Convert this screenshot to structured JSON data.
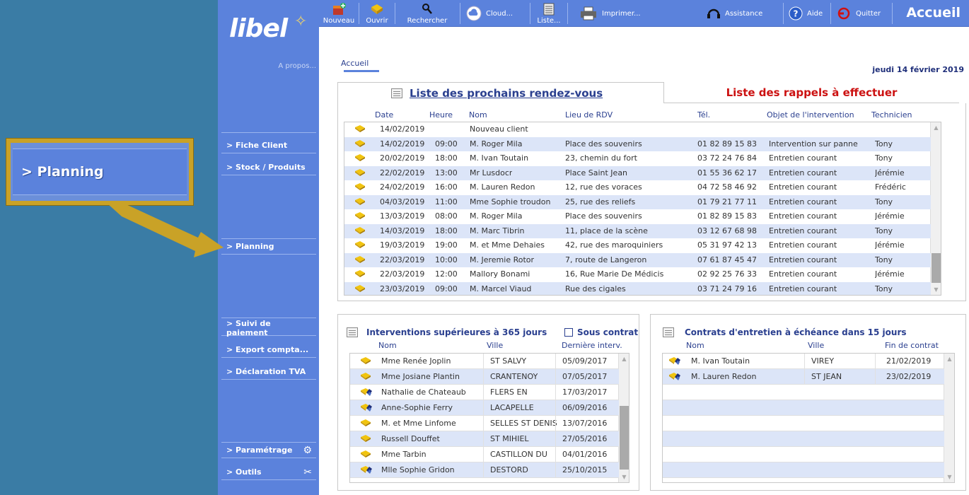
{
  "callout": {
    "label": ">  Planning"
  },
  "app": {
    "logo": "libel",
    "apropos": "A propos..."
  },
  "sidebar": {
    "items": [
      {
        "label": "> Fiche Client",
        "icon": ""
      },
      {
        "label": "> Stock / Produits",
        "icon": ""
      },
      {
        "label": "> Planning",
        "icon": ""
      },
      {
        "label": "> Suivi de paiement",
        "icon": ""
      },
      {
        "label": "> Export compta...",
        "icon": ""
      },
      {
        "label": "> Déclaration TVA",
        "icon": ""
      },
      {
        "label": "> Paramétrage",
        "icon": "gears-icon"
      },
      {
        "label": "> Outils",
        "icon": "tools-icon"
      }
    ]
  },
  "toolbar": {
    "nouveau": "Nouveau",
    "ouvrir": "Ouvrir",
    "rechercher": "Rechercher",
    "cloud": "Cloud...",
    "liste": "Liste...",
    "imprimer": "Imprimer...",
    "assistance": "Assistance",
    "aide": "Aide",
    "quitter": "Quitter",
    "title": "Accueil"
  },
  "content": {
    "breadcrumb": "Accueil",
    "date": "jeudi 14 février 2019"
  },
  "tabs": {
    "active": "Liste des prochains rendez-vous",
    "inactive": "Liste des rappels à effectuer"
  },
  "rdv_table": {
    "headers": [
      "Date",
      "Heure",
      "Nom",
      "Lieu de RDV",
      "Tél.",
      "Objet  de l'intervention",
      "Technicien"
    ],
    "rows": [
      [
        "14/02/2019",
        "",
        "Nouveau client",
        "",
        "",
        "",
        ""
      ],
      [
        "14/02/2019",
        "09:00",
        "M. Roger Mila",
        "Place des souvenirs",
        "01 82 89 15 83",
        "Intervention sur panne",
        "Tony"
      ],
      [
        "20/02/2019",
        "18:00",
        "M. Ivan Toutain",
        "23, chemin du fort",
        "03 72 24 76 84",
        "Entretien courant",
        "Tony"
      ],
      [
        "22/02/2019",
        "13:00",
        "Mr Lusdocr",
        "Place Saint Jean",
        "01 55 36 62 17",
        "Entretien courant",
        "Jérémie"
      ],
      [
        "24/02/2019",
        "16:00",
        "M. Lauren Redon",
        "12, rue des voraces",
        "04 72 58 46 92",
        "Entretien courant",
        "Frédéric"
      ],
      [
        "04/03/2019",
        "11:00",
        "Mme Sophie troudon",
        "25, rue des reliefs",
        "01 79 21 77 11",
        "Entretien courant",
        "Tony"
      ],
      [
        "13/03/2019",
        "08:00",
        "M. Roger Mila",
        "Place des souvenirs",
        "01 82 89 15 83",
        "Entretien courant",
        "Jérémie"
      ],
      [
        "14/03/2019",
        "18:00",
        "M. Marc Tibrin",
        "11, place de la scène",
        "03 12 67 68 98",
        "Entretien courant",
        "Tony"
      ],
      [
        "19/03/2019",
        "19:00",
        "M. et Mme Dehaies",
        "42, rue des maroquiniers",
        "05 31 97 42 13",
        "Entretien courant",
        "Jérémie"
      ],
      [
        "22/03/2019",
        "10:00",
        "M. Jeremie Rotor",
        "7, route de Langeron",
        "07 61 87 45 47",
        "Entretien courant",
        "Tony"
      ],
      [
        "22/03/2019",
        "12:00",
        "Mallory Bonami",
        "16, Rue Marie De Médicis",
        "02 92 25 76 33",
        "Entretien courant",
        "Jérémie"
      ],
      [
        "23/03/2019",
        "09:00",
        "M. Marcel Viaud",
        "Rue des cigales",
        "03 71 24 79 16",
        "Entretien courant",
        "Tony"
      ]
    ]
  },
  "interventions": {
    "title": "Interventions supérieures à 365 jours",
    "sous_contrat": "Sous contrat",
    "headers": [
      "Nom",
      "Ville",
      "Dernière interv."
    ],
    "rows": [
      [
        "Mme Renée Joplin",
        "ST SALVY",
        "05/09/2017",
        "single"
      ],
      [
        "Mme Josiane Plantin",
        "CRANTENOY",
        "07/05/2017",
        "single"
      ],
      [
        "Nathalie de Chateaub",
        "FLERS EN",
        "17/03/2017",
        "double"
      ],
      [
        "Anne-Sophie Ferry",
        "LACAPELLE",
        "06/09/2016",
        "double"
      ],
      [
        "M. et Mme Linfome",
        "SELLES ST DENIS",
        "13/07/2016",
        "single"
      ],
      [
        "Russell Douffet",
        "ST MIHIEL",
        "27/05/2016",
        "single"
      ],
      [
        "Mme Tarbin",
        "CASTILLON DU",
        "04/01/2016",
        "single"
      ],
      [
        "Mlle Sophie Gridon",
        "DESTORD",
        "25/10/2015",
        "double"
      ]
    ]
  },
  "contrats": {
    "title": "Contrats d'entretien à échéance dans 15 jours",
    "headers": [
      "Nom",
      "Ville",
      "Fin de contrat"
    ],
    "rows": [
      [
        "M. Ivan Toutain",
        "VIREY",
        "21/02/2019"
      ],
      [
        "M. Lauren Redon",
        "ST JEAN",
        "23/02/2019"
      ]
    ]
  },
  "colors": {
    "accent": "#5b82dc",
    "row_alt": "#dce5f8",
    "heading": "#2a3f8f",
    "alert": "#cc1111",
    "callout_border": "#c9a227"
  }
}
